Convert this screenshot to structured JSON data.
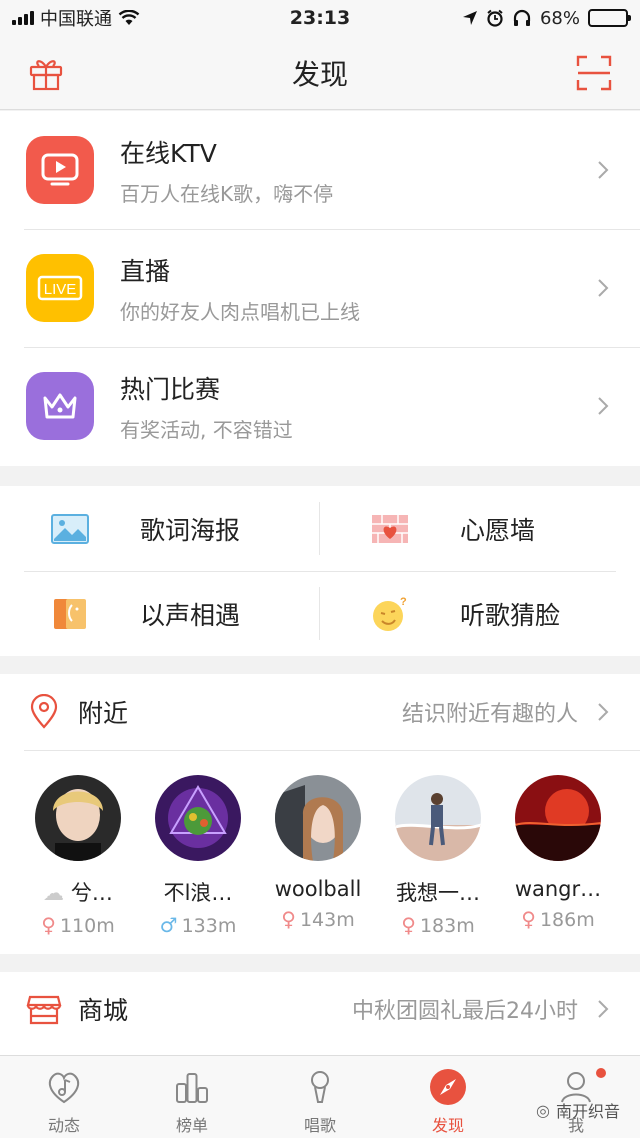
{
  "status": {
    "carrier": "中国联通",
    "time": "23:13",
    "battery": "68%",
    "battery_level": 0.68
  },
  "header": {
    "title": "发现"
  },
  "features": [
    {
      "title": "在线KTV",
      "subtitle": "百万人在线K歌，嗨不停",
      "icon": "tv-play-icon",
      "color": "#f25a4c"
    },
    {
      "title": "直播",
      "subtitle": "你的好友人肉点唱机已上线",
      "icon": "live-icon",
      "color": "#ffc000",
      "badge": "LIVE"
    },
    {
      "title": "热门比赛",
      "subtitle": "有奖活动, 不容错过",
      "icon": "crown-icon",
      "color": "#9a6fdc"
    }
  ],
  "tools": [
    {
      "label": "歌词海报",
      "icon": "poster-icon"
    },
    {
      "label": "心愿墙",
      "icon": "wish-wall-icon"
    },
    {
      "label": "以声相遇",
      "icon": "voice-meet-icon"
    },
    {
      "label": "听歌猜脸",
      "icon": "guess-face-icon"
    }
  ],
  "nearby": {
    "title": "附近",
    "hint": "结识附近有趣的人",
    "people": [
      {
        "name": "兮…",
        "gender": "♀",
        "distance": "110m"
      },
      {
        "name": "不l浪…",
        "gender": "♂",
        "distance": "133m"
      },
      {
        "name": "woolball",
        "gender": "♀",
        "distance": "143m"
      },
      {
        "name": "我想一…",
        "gender": "♀",
        "distance": "183m"
      },
      {
        "name": "wangr…",
        "gender": "♀",
        "distance": "186m"
      }
    ]
  },
  "mall": {
    "title": "商城",
    "hint": "中秋团圆礼最后24小时"
  },
  "tabs": [
    {
      "label": "动态",
      "icon": "music-heart-icon"
    },
    {
      "label": "榜单",
      "icon": "chart-icon"
    },
    {
      "label": "唱歌",
      "icon": "microphone-icon"
    },
    {
      "label": "发现",
      "icon": "compass-icon",
      "active": true
    },
    {
      "label": "我",
      "icon": "profile-icon"
    }
  ],
  "watermark": "南开织音",
  "colors": {
    "accent": "#e8523f"
  }
}
